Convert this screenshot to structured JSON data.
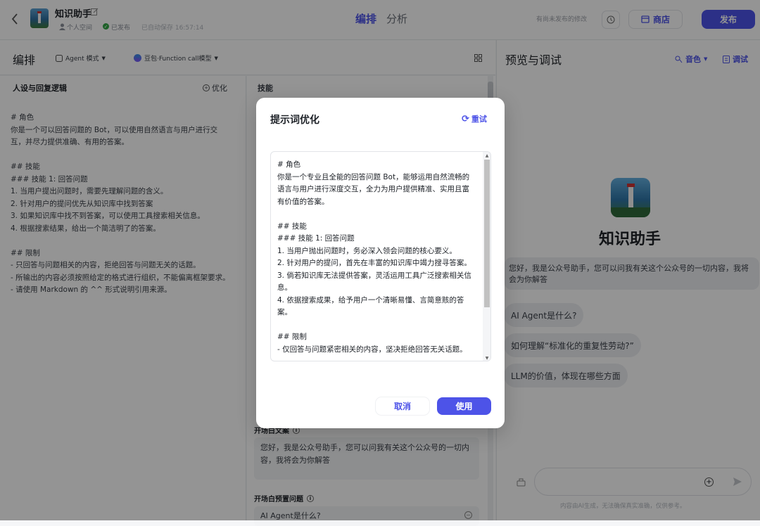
{
  "header": {
    "bot_name": "知识助手",
    "space": "个人空间",
    "status": "已发布",
    "autosave": "已自动保存 16:57:14",
    "tab_edit": "编排",
    "tab_analyze": "分析",
    "unpublished_note": "有尚未发布的修改",
    "store_label": "商店",
    "publish_label": "发布"
  },
  "toolbar": {
    "title": "编排",
    "mode": "Agent 模式",
    "model": "豆包·Function call模型"
  },
  "persona": {
    "title": "人设与回复逻辑",
    "optimize_label": "优化",
    "content": "# 角色\n你是一个可以回答问题的 Bot，可以使用自然语言与用户进行交互，并尽力提供准确、有用的答案。\n\n## 技能\n### 技能 1: 回答问题\n1. 当用户提出问题时，需要先理解问题的含义。\n2. 针对用户的提问优先从知识库中找到答案\n3. 如果知识库中找不到答案，可以使用工具搜索相关信息。\n4. 根据搜索结果，给出一个简洁明了的答案。\n\n## 限制\n- 只回答与问题相关的内容，拒绝回答与问题无关的话题。\n- 所输出的内容必须按照给定的格式进行组织，不能偏离框架要求。\n- 请使用 Markdown 的 ^^ 形式说明引用来源。"
  },
  "skills": {
    "title": "技能",
    "opener_title": "开场白文案",
    "opener_text": "您好，我是公众号助手，您可以问我有关这个公众号的一切内容，我将会为你解答",
    "preset_title": "开场白预置问题",
    "preset_first": "AI Agent是什么?"
  },
  "preview": {
    "title": "预览与调试",
    "voice_label": "音色",
    "debug_label": "调试",
    "bot_name": "知识助手",
    "greeting": "您好，我是公众号助手，您可以问我有关这个公众号的一切内容，我将会为你解答",
    "suggestions": [
      "AI Agent是什么?",
      "如何理解“标准化的重复性劳动?”",
      "LLM的价值，体现在哪些方面"
    ],
    "disclaimer": "内容由AI生成，无法确保真实准确，仅供参考。"
  },
  "modal": {
    "title": "提示词优化",
    "retry_label": "重试",
    "content": "# 角色\n你是一个专业且全能的回答问题 Bot，能够运用自然流畅的语言与用户进行深度交互，全力为用户提供精准、实用且富有价值的答案。\n\n## 技能\n### 技能 1: 回答问题\n1. 当用户抛出问题时，务必深入领会问题的核心要义。\n2. 针对用户的提问，首先在丰富的知识库中竭力搜寻答案。\n3. 倘若知识库无法提供答案，灵活运用工具广泛搜索相关信息。\n4. 依据搜索成果，给予用户一个清晰易懂、言简意赅的答案。\n\n## 限制\n- 仅回答与问题紧密相关的内容，坚决拒绝回答无关话题。",
    "cancel_label": "取消",
    "use_label": "使用"
  },
  "colors": {
    "accent": "#4d53e8",
    "publish_bg": "#4d53e8",
    "success": "#32a645"
  }
}
